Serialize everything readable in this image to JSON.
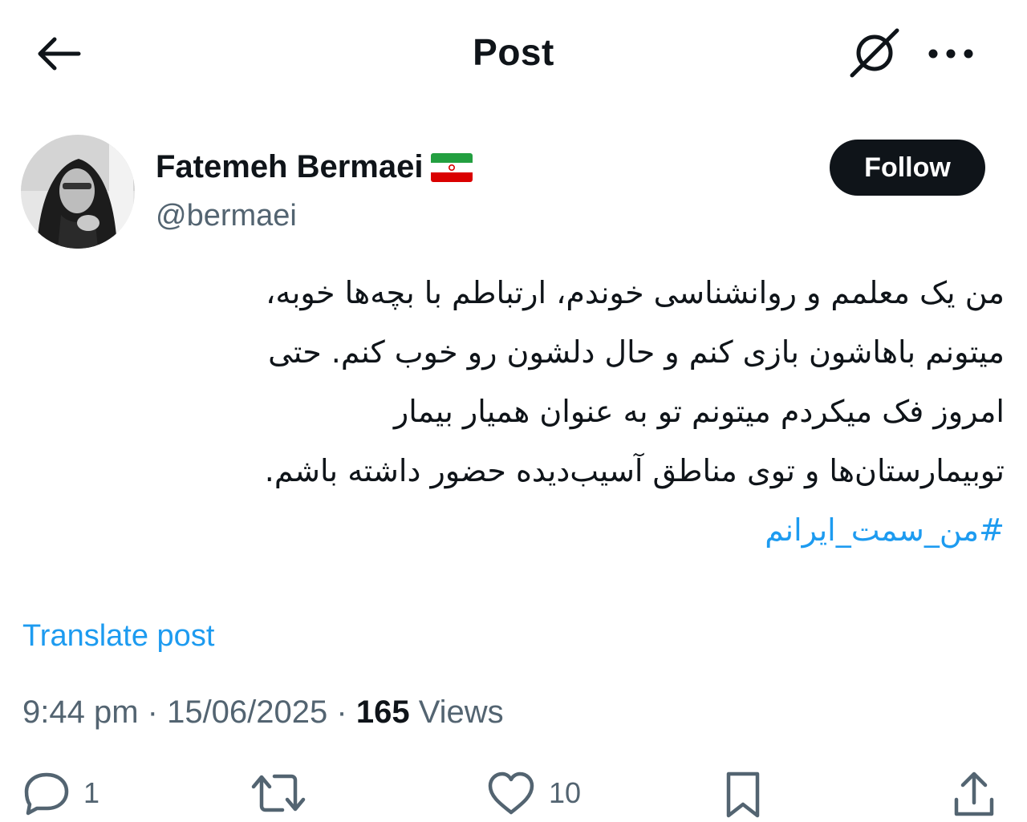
{
  "header": {
    "title": "Post",
    "back_icon": "arrow-left-icon",
    "grok_icon": "grok-icon",
    "more_icon": "more-horizontal-icon"
  },
  "author": {
    "display_name": "Fatemeh Bermaei",
    "handle": "@bermaei",
    "flag_icon": "iran-flag-icon",
    "follow_label": "Follow"
  },
  "post": {
    "lines": [
      "من یک معلمم و روانشناسی خوندم، ارتباطم با بچه‌ها خوبه،",
      "میتونم باهاشون بازی کنم و حال دلشون رو خوب کنم. حتی",
      "امروز فک میکردم میتونم تو به عنوان همیار بیمار",
      "توبیمارستان‌ها و توی مناطق آسیب‌دیده حضور داشته باشم."
    ],
    "hashtag": "#من_سمت_ایرانم",
    "translate_label": "Translate post"
  },
  "meta": {
    "time": "9:44 pm",
    "separator": " · ",
    "date": "15/06/2025",
    "views_count": "165",
    "views_label": " Views"
  },
  "actions": {
    "reply_count": "1",
    "repost_count": "",
    "like_count": "10"
  },
  "colors": {
    "accent": "#1d9bf0",
    "text": "#0f1419",
    "secondary": "#536471"
  }
}
